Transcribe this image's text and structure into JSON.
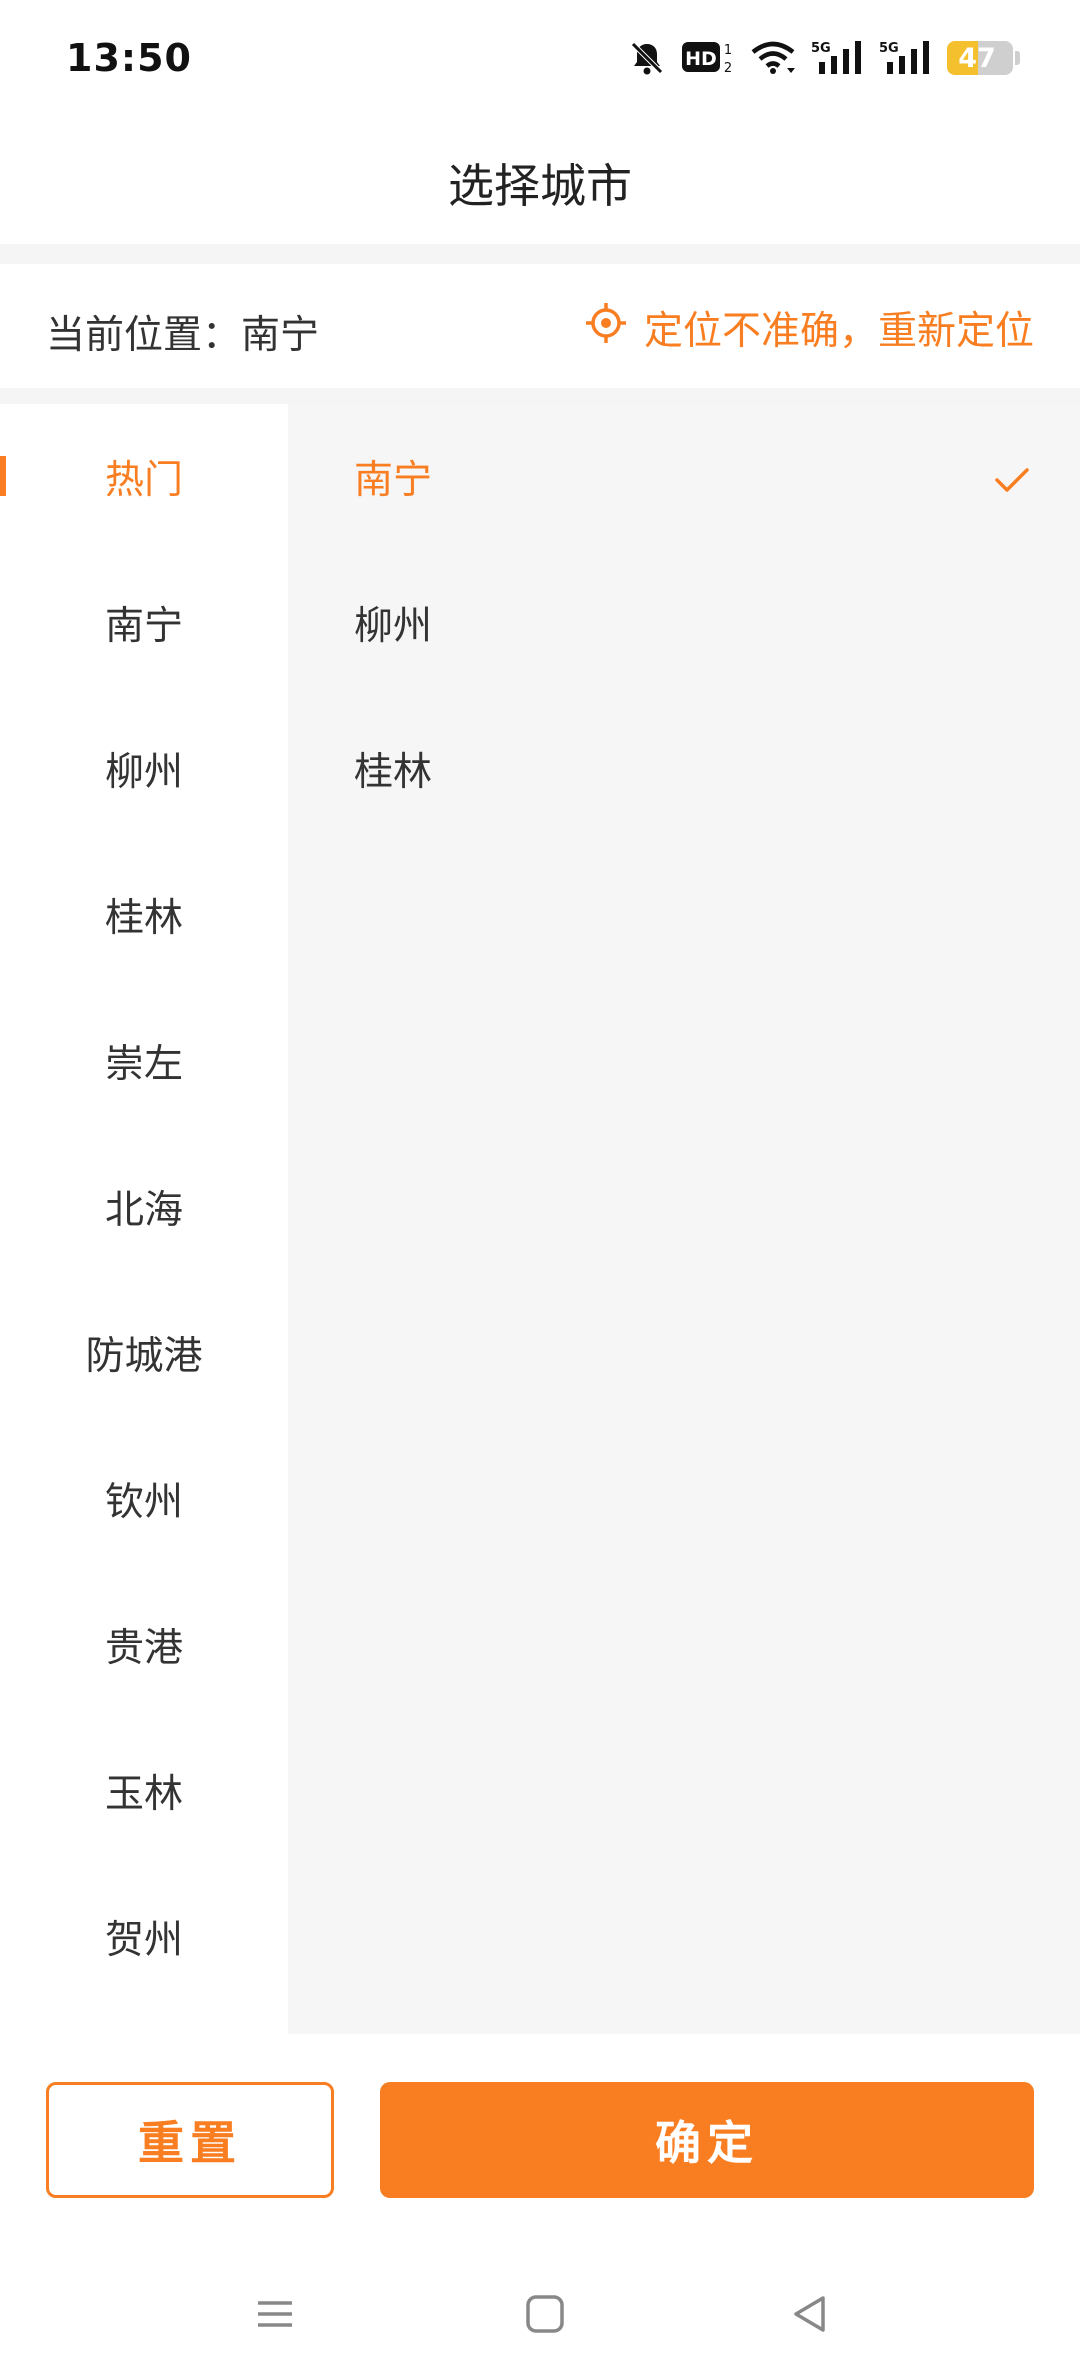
{
  "status_bar": {
    "time": "13:50",
    "icons": [
      "bell-off-icon",
      "hd-icon",
      "wifi-icon",
      "signal-5g-icon",
      "signal-5g-icon"
    ],
    "battery_level": 47,
    "battery_label": "47"
  },
  "header": {
    "title": "选择城市"
  },
  "location": {
    "current_label": "当前位置：南宁",
    "relocate_label": "定位不准确，重新定位"
  },
  "provinces": [
    {
      "label": "热门",
      "active": true
    },
    {
      "label": "南宁"
    },
    {
      "label": "柳州"
    },
    {
      "label": "桂林"
    },
    {
      "label": "崇左"
    },
    {
      "label": "北海"
    },
    {
      "label": "防城港"
    },
    {
      "label": "钦州"
    },
    {
      "label": "贵港"
    },
    {
      "label": "玉林"
    },
    {
      "label": "贺州"
    }
  ],
  "cities": [
    {
      "label": "南宁",
      "selected": true
    },
    {
      "label": "柳州"
    },
    {
      "label": "桂林"
    }
  ],
  "footer": {
    "reset_label": "重置",
    "confirm_label": "确定"
  },
  "colors": {
    "accent": "#f97e22",
    "panel_bg": "#f6f6f6",
    "text": "#333333"
  },
  "nav": [
    "menu-icon",
    "home-icon",
    "back-icon"
  ]
}
